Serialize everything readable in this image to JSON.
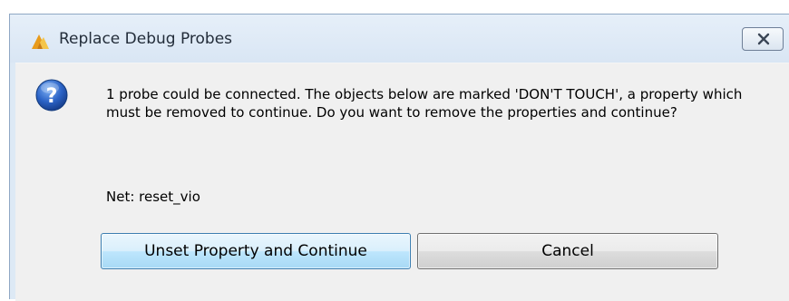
{
  "window": {
    "title": "Replace Debug Probes",
    "icon": "xilinx-logo-icon",
    "close_icon": "close-icon"
  },
  "dialog": {
    "icon": "question-icon",
    "message": "1 probe could be connected. The objects below are marked 'DON'T TOUCH', a property which must be removed to continue. Do you want to remove the properties and continue?",
    "net_label": "Net: reset_vio"
  },
  "buttons": {
    "primary_label": "Unset Property and Continue",
    "cancel_label": "Cancel"
  },
  "colors": {
    "frame": "#dde9f5",
    "content_bg": "#f0f0f0",
    "primary_button": "#bee6fd",
    "question_icon": "#2b63c6"
  }
}
